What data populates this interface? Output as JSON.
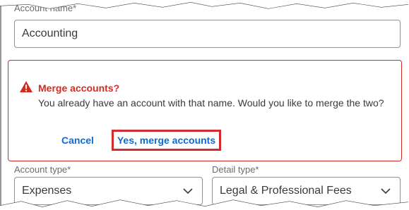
{
  "account_name": {
    "label": "Account name*",
    "value": "Accounting"
  },
  "merge_alert": {
    "title": "Merge accounts?",
    "message": "You already have an account with that name. Would you like to merge the two?",
    "cancel_label": "Cancel",
    "confirm_label": "Yes, merge accounts",
    "icon": "warning-icon",
    "color": "#d52b1e"
  },
  "account_type": {
    "label": "Account type*",
    "value": "Expenses",
    "icon": "chevron-down-icon"
  },
  "detail_type": {
    "label": "Detail type*",
    "value": "Legal & Professional Fees",
    "icon": "chevron-down-icon"
  },
  "colors": {
    "link": "#0d6cd3",
    "highlight_box": "#d52b2e"
  }
}
